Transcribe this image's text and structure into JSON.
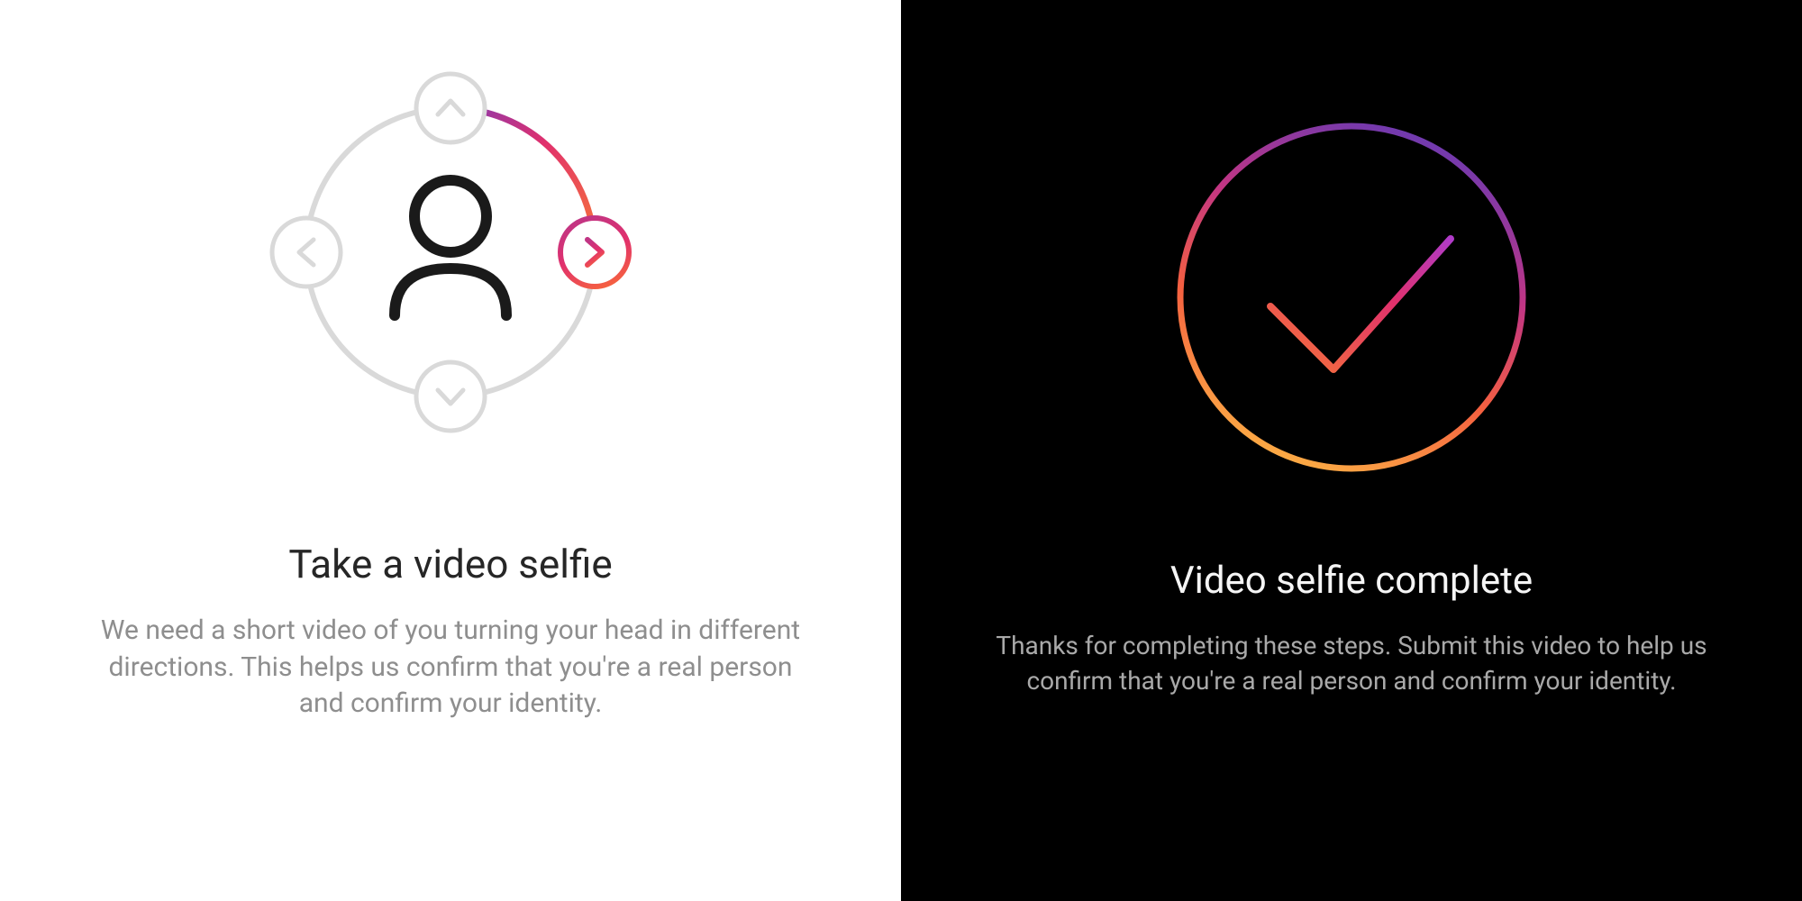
{
  "left": {
    "heading": "Take a video selfie",
    "description": "We need a short video of you turning your head in different directions. This helps us confirm that you're a real person and confirm your identity."
  },
  "right": {
    "heading": "Video selfie complete",
    "description": "Thanks for completing these steps. Submit this video to help us confirm that you're a real person and confirm your identity."
  },
  "colors": {
    "gradient_purple": "#833AB4",
    "gradient_pink": "#E1306C",
    "gradient_orange": "#F77737",
    "gradient_yellow": "#FCAF45",
    "light_gray": "#d9d9d9",
    "text_gray": "#8e8e8e",
    "dark_text_gray": "#a9a9a9"
  }
}
